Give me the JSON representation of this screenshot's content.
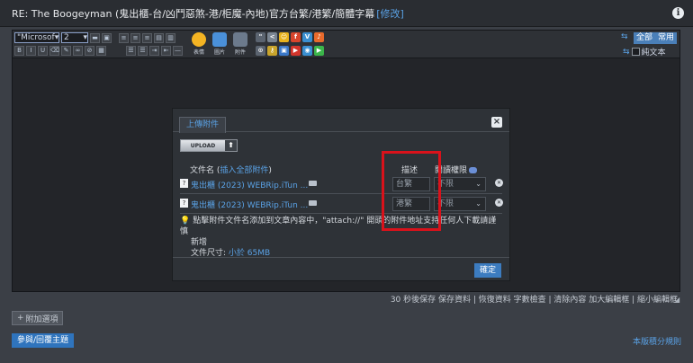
{
  "header": {
    "title": "RE: The Boogeyman (鬼出櫃-台/凶鬥惡煞-港/柜魔-內地)官方台繁/港繁/簡體字幕",
    "edit_link": "[修改]"
  },
  "toolbar": {
    "font_select": "\"Microsof",
    "size_select": "2",
    "big_buttons": [
      {
        "label": "表情",
        "icon": "emoji-icon",
        "color": "#f4b423"
      },
      {
        "label": "圖片",
        "icon": "image-icon",
        "color": "#4a90d9"
      },
      {
        "label": "附件",
        "icon": "paperclip-icon",
        "color": "#6c7a8c"
      }
    ],
    "mode_full": "全部",
    "mode_common": "常用",
    "plain_text_label": "純文本"
  },
  "dialog": {
    "tab_label": "上傳附件",
    "upload_label": "UPLOAD",
    "filename_header": "文件名 (",
    "insert_all_link": "插入全部附件",
    "filename_header_end": ")",
    "description_header": "描述",
    "permission_header": "閱讀權限",
    "files": [
      {
        "name": "鬼出櫃 (2023) WEBRip.iTun ...",
        "description": "台繁",
        "permission": "不限"
      },
      {
        "name": "鬼出櫃 (2023) WEBRip.iTun ...",
        "description": "港繁",
        "permission": "不限"
      }
    ],
    "tip_text": "點擊附件文件名添加到文章內容中，\"attach://\" 開頭的附件地址支持任何人下載請謹慎",
    "tip_text_2": "新增",
    "size_label": "文件尺寸:",
    "size_value": "小於 65MB",
    "confirm_label": "確定"
  },
  "footer": {
    "links": "30 秒後保存 保存資料 | 恢復資料  字數檢查 | 清除內容  加大編輯框 | 縮小編輯框",
    "options_label": "附加選項",
    "submit_label": "參與/回覆主題",
    "rules_link": "本版積分規則"
  },
  "colors": {
    "link": "#5aa2e6",
    "accent_button": "#2f74bd",
    "highlight_box": "#d9121b"
  }
}
